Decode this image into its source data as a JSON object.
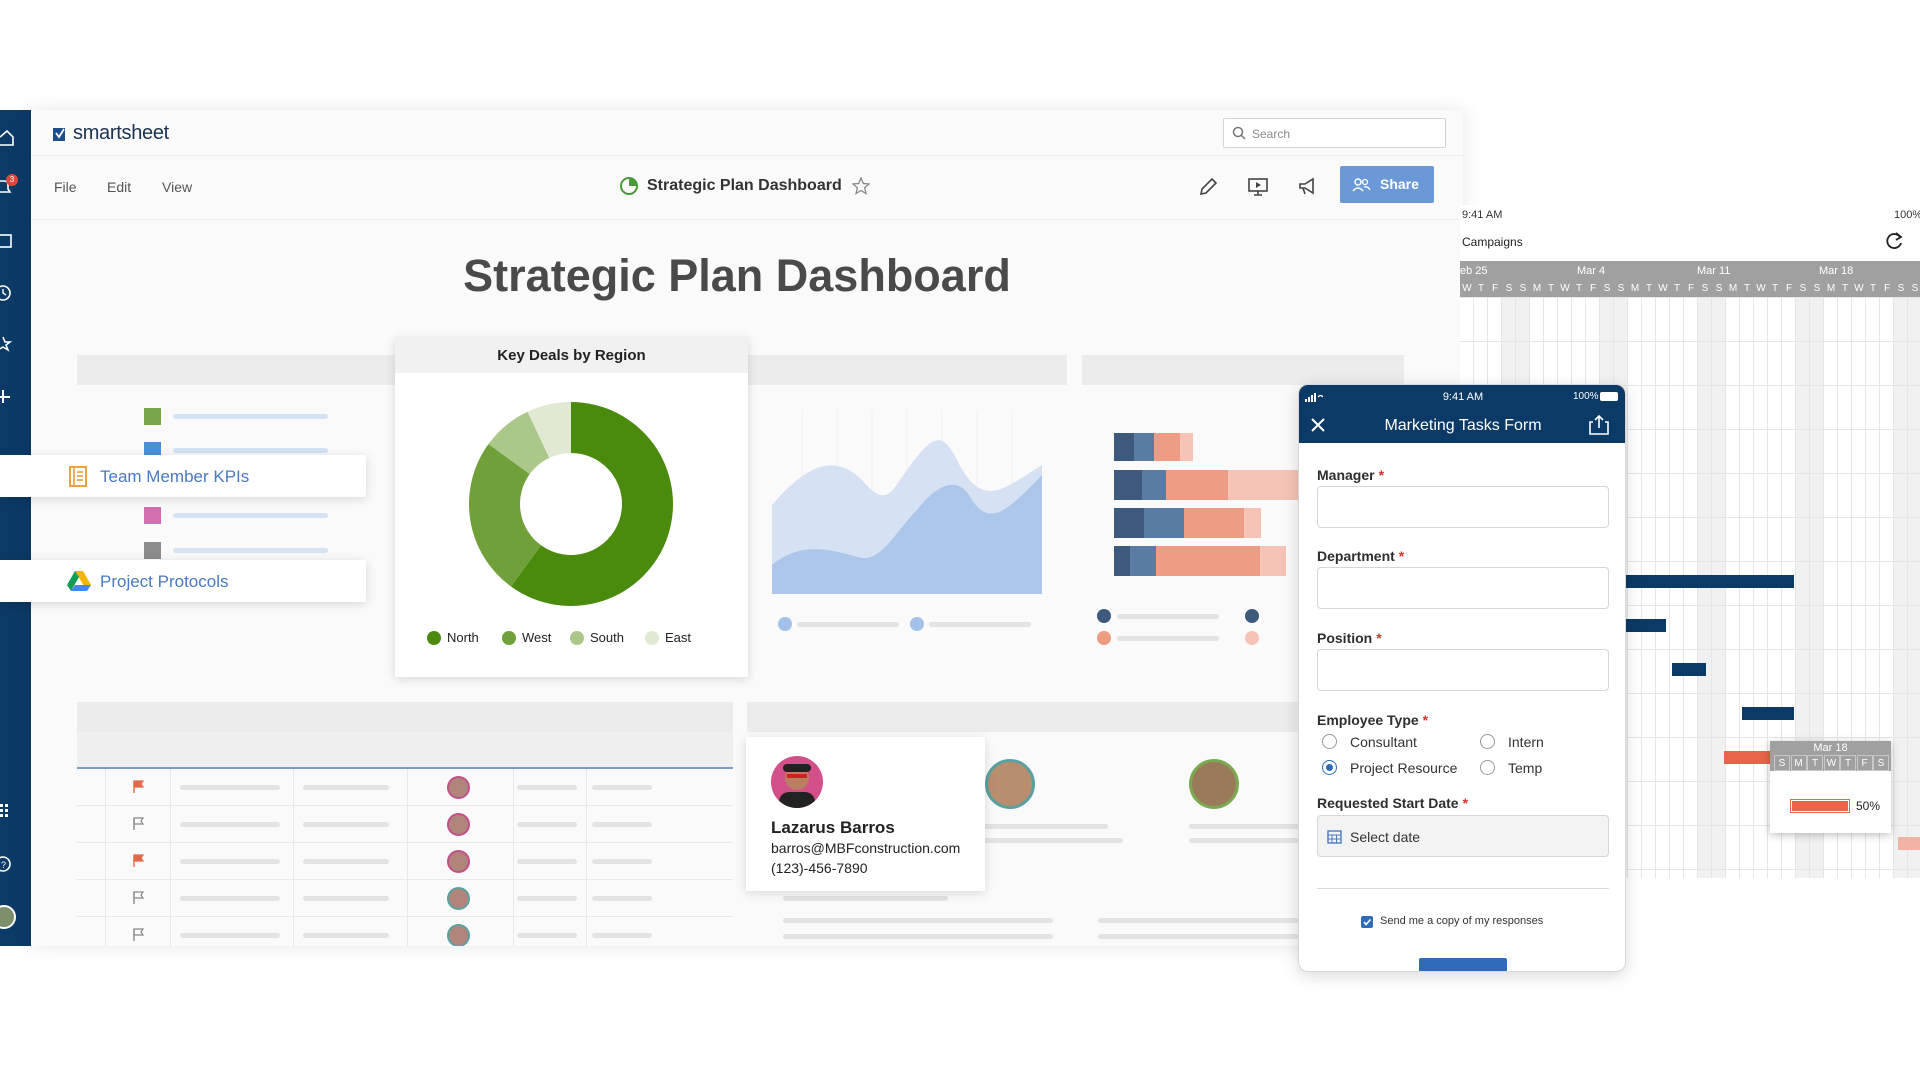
{
  "app": {
    "logo_text": "smartsheet",
    "search_placeholder": "Search",
    "notification_count": "3",
    "menu": [
      "File",
      "Edit",
      "View"
    ],
    "sheet_title": "Strategic Plan Dashboard",
    "share_label": "Share",
    "colors": {
      "nav": "#0c3a66",
      "share": "#6b98d6",
      "accent_green": "#4a8a0c"
    }
  },
  "dashboard": {
    "heading": "Strategic Plan Dashboard",
    "links": [
      {
        "label": "Team Member KPIs",
        "icon": "kpi-notebook-icon"
      },
      {
        "label": "Project Protocols",
        "icon": "drive-icon"
      }
    ],
    "legend_swatches": [
      "#7aa64a",
      "#4a90d9",
      "#d36fae",
      "#8c8c8c"
    ],
    "donut_card": {
      "title": "Key Deals by Region"
    },
    "contact": {
      "name": "Lazarus Barros",
      "email": "barros@MBFconstruction.com",
      "phone": "(123)-456-7890"
    }
  },
  "chart_data": {
    "type": "pie",
    "title": "Key Deals by Region",
    "categories": [
      "North",
      "West",
      "South",
      "East"
    ],
    "values": [
      60,
      25,
      8,
      7
    ],
    "colors": [
      "#4a8a0c",
      "#6fa03a",
      "#abc78a",
      "#dfe9d3"
    ],
    "legend_position": "bottom"
  },
  "form": {
    "status_time": "9:41 AM",
    "battery": "100%",
    "title": "Marketing Tasks Form",
    "fields": [
      {
        "label": "Manager",
        "required": "*"
      },
      {
        "label": "Department",
        "required": "*"
      },
      {
        "label": "Position",
        "required": "*"
      }
    ],
    "employee_type": {
      "label": "Employee Type",
      "required": "*",
      "options": [
        "Consultant",
        "Intern",
        "Project Resource",
        "Temp"
      ],
      "selected": "Project Resource"
    },
    "start_date": {
      "label": "Requested Start Date",
      "required": "*",
      "placeholder": "Select date"
    },
    "copy_label": "Send me a copy of my responses",
    "copy_checked": true
  },
  "gantt": {
    "status_time": "9:41 AM",
    "battery": "100%",
    "sheet_name": "Campaigns",
    "weeks": [
      "eb 25",
      "Mar 4",
      "Mar 11",
      "Mar 18"
    ],
    "days": [
      "W",
      "T",
      "F",
      "S",
      "S",
      "M",
      "T",
      "W",
      "T",
      "F",
      "S",
      "S",
      "M",
      "T",
      "W",
      "T",
      "F",
      "S",
      "S",
      "M",
      "T",
      "W",
      "T",
      "F",
      "S",
      "S",
      "M",
      "T",
      "W",
      "T",
      "F",
      "S",
      "S"
    ],
    "popup": {
      "week": "Mar 18",
      "days": [
        "S",
        "M",
        "T",
        "W",
        "T",
        "F",
        "S"
      ],
      "progress": 0.5,
      "progress_label": "50%"
    }
  }
}
